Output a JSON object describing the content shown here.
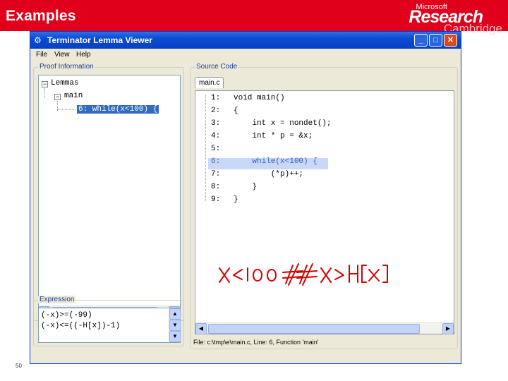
{
  "slide": {
    "title": "Examples",
    "number": "50",
    "logo": {
      "top": "Microsoft",
      "middle": "Research",
      "bottom": "Cambridge"
    }
  },
  "window": {
    "title": "Terminator Lemma Viewer",
    "app_icon": "gear-icon",
    "buttons": {
      "minimize": "_",
      "maximize": "□",
      "close": "✕"
    },
    "menu": [
      "File",
      "View",
      "Help"
    ]
  },
  "proof": {
    "label": "Proof Information",
    "tree": {
      "root": "Lemmas",
      "child": "main",
      "leaf": "6: while(x<100) {"
    }
  },
  "expression": {
    "label": "Expression",
    "lines": [
      "(-x)>=(-99)",
      "(-x)<=((-H[x])-1)"
    ]
  },
  "source": {
    "label": "Source Code",
    "tab": "main.c",
    "lines": [
      {
        "num": "1:",
        "text": "void main()"
      },
      {
        "num": "2:",
        "text": "{"
      },
      {
        "num": "3:",
        "text": "    int x = nondet();"
      },
      {
        "num": "4:",
        "text": "    int * p = &x;"
      },
      {
        "num": "5:",
        "text": ""
      },
      {
        "num": "6:",
        "text": "    while(x<100) {"
      },
      {
        "num": "7:",
        "text": "        (*p)++;"
      },
      {
        "num": "8:",
        "text": "    }"
      },
      {
        "num": "9:",
        "text": "}"
      }
    ],
    "highlight_line": 6,
    "status": "File: c:\\tmp\\e\\main.c,   Line: 6,   Function 'main'"
  },
  "annotation": {
    "text": "x < 100 && x > H[x]",
    "color": "#d40000"
  }
}
